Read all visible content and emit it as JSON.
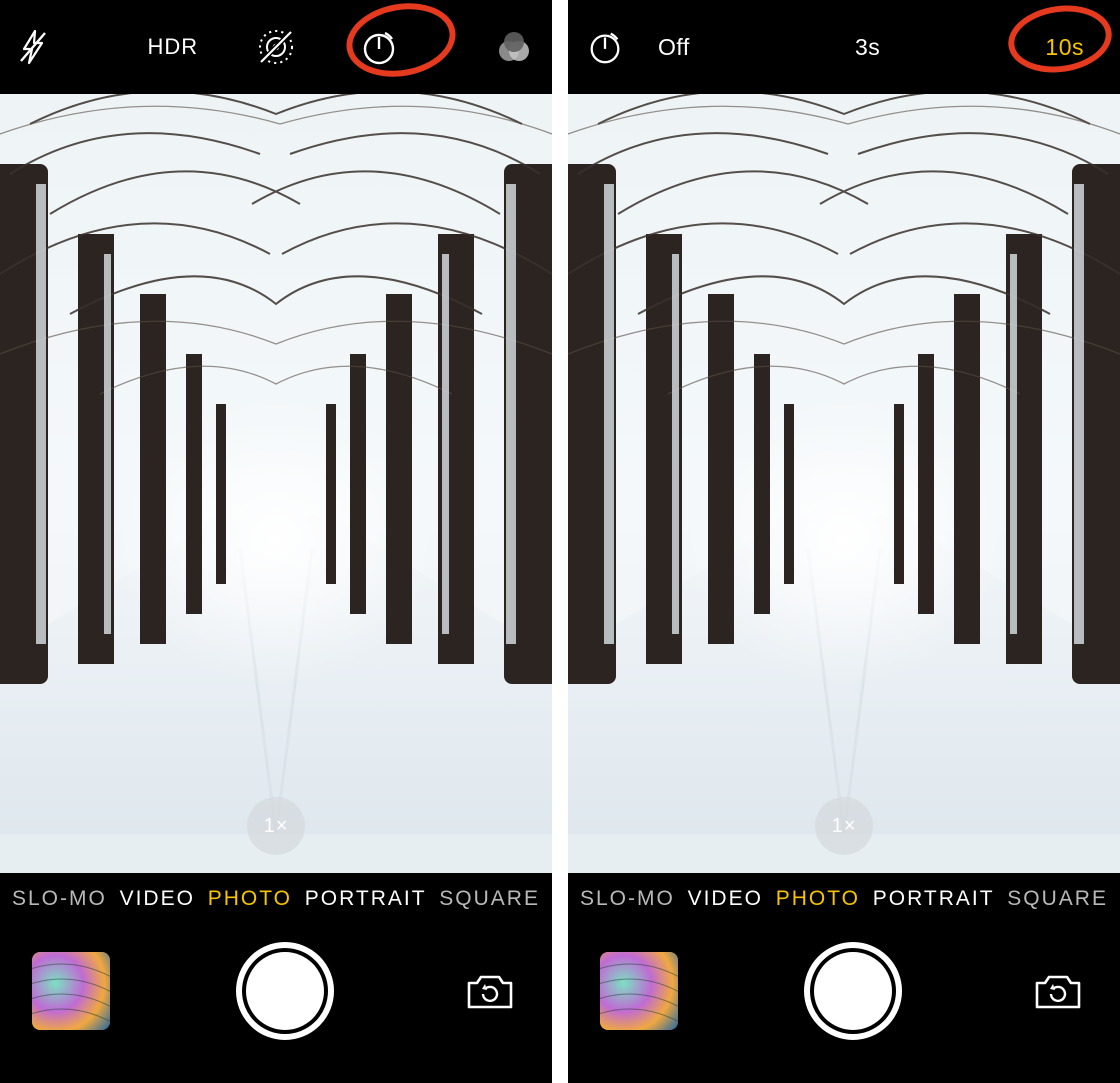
{
  "left": {
    "topbar": {
      "hdr": "HDR"
    },
    "zoom": "1×",
    "modes": [
      "SLO-MO",
      "VIDEO",
      "PHOTO",
      "PORTRAIT",
      "SQUARE"
    ],
    "selected_mode_index": 2
  },
  "right": {
    "timer_options": [
      "Off",
      "3s",
      "10s"
    ],
    "selected_timer_index": 2,
    "zoom": "1×",
    "modes": [
      "SLO-MO",
      "VIDEO",
      "PHOTO",
      "PORTRAIT",
      "SQUARE"
    ],
    "selected_mode_index": 2
  },
  "icons": {
    "flash_off": "flash-off-icon",
    "live_off": "live-photo-off-icon",
    "timer": "timer-icon",
    "filters": "filters-icon",
    "flip": "flip-camera-icon"
  },
  "annotation": {
    "color": "#e53a1e",
    "targets": [
      "timer-icon",
      "timer-option-10s"
    ]
  }
}
